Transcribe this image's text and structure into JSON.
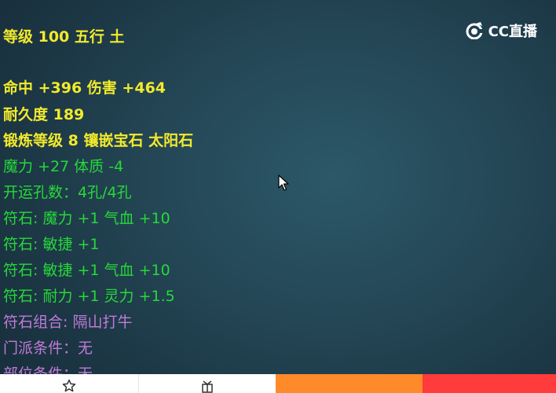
{
  "brand": {
    "logo_text": "CC直播"
  },
  "item_stats": [
    {
      "text": "等级 100 五行 土",
      "style": "yellow"
    },
    {
      "text": "命中 +396 伤害 +464",
      "style": "yellow"
    },
    {
      "text": "耐久度 189",
      "style": "yellow"
    },
    {
      "text": "锻炼等级 8 镶嵌宝石 太阳石",
      "style": "yellow"
    },
    {
      "text": "魔力 +27 体质 -4",
      "style": "green"
    },
    {
      "text": "开运孔数：4孔/4孔",
      "style": "green"
    },
    {
      "text": "符石: 魔力 +1 气血 +10",
      "style": "green"
    },
    {
      "text": "符石: 敏捷 +1",
      "style": "green"
    },
    {
      "text": "符石: 敏捷 +1 气血 +10",
      "style": "green"
    },
    {
      "text": "符石: 耐力 +1 灵力 +1.5",
      "style": "green"
    },
    {
      "text": "符石组合: 隔山打牛",
      "style": "purple"
    },
    {
      "text": "门派条件：无",
      "style": "purple"
    },
    {
      "text": "部位条件：无",
      "style": "purple"
    }
  ],
  "bottom_bar": {
    "favorite_icon": "star-icon",
    "gift_icon": "gift-icon",
    "orange_label": "",
    "red_label": ""
  },
  "colors": {
    "stat_yellow": "#f2ea2c",
    "stat_green": "#27d83a",
    "stat_purple": "#c07ad8",
    "bar_orange": "#ff8a2a",
    "bar_red": "#ff3b3b"
  }
}
